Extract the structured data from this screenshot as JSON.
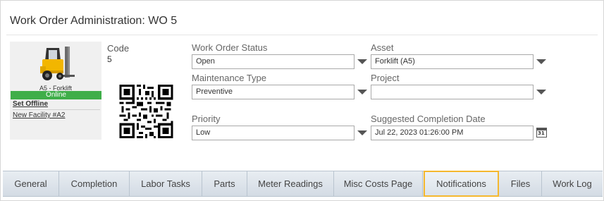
{
  "header": {
    "title": "Work Order Administration: WO 5"
  },
  "asset_card": {
    "name": "A5 - Forklift",
    "status": "Online",
    "status_color": "#3fae49",
    "set_offline_label": "Set Offline",
    "facility_link": "New Facility #A2",
    "image_icon": "forklift-icon"
  },
  "code": {
    "label": "Code",
    "value": "5"
  },
  "fields": {
    "work_order_status": {
      "label": "Work Order Status",
      "value": "Open"
    },
    "asset": {
      "label": "Asset",
      "value": "Forklift (A5)"
    },
    "maintenance_type": {
      "label": "Maintenance Type",
      "value": "Preventive"
    },
    "project": {
      "label": "Project",
      "value": ""
    },
    "priority": {
      "label": "Priority",
      "value": "Low"
    },
    "suggested_completion_date": {
      "label": "Suggested Completion Date",
      "value": "Jul 22, 2023 01:26:00 PM",
      "calendar_day": "31"
    }
  },
  "tabs": [
    {
      "label": "General"
    },
    {
      "label": "Completion"
    },
    {
      "label": "Labor Tasks"
    },
    {
      "label": "Parts"
    },
    {
      "label": "Meter Readings"
    },
    {
      "label": "Misc Costs Page"
    },
    {
      "label": "Notifications",
      "active": true
    },
    {
      "label": "Files"
    },
    {
      "label": "Work Log"
    }
  ],
  "colors": {
    "active_tab_border": "#f5b82e",
    "tabbar_bg": "#dce3ea"
  }
}
